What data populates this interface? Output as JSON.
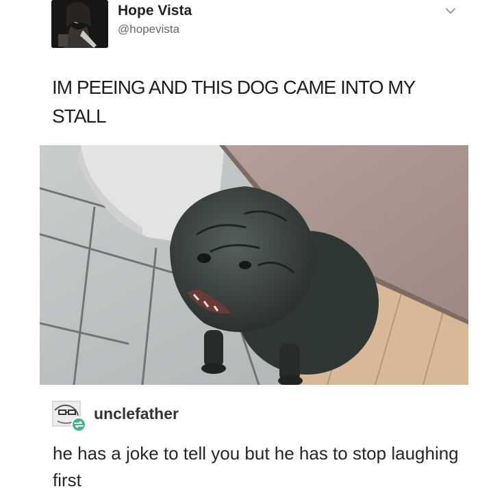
{
  "tweet": {
    "display_name": "Hope Vista",
    "handle": "@hopevista",
    "text": "IM PEEING AND THIS DOG CAME INTO MY STALL",
    "menu_icon": "chevron-down-icon",
    "photo_subject": "dog-photo"
  },
  "reply": {
    "username": "unclefather",
    "text": "he has a joke to tell you but he has to stop laughing first",
    "badge_icon": "tumblr-reblog-badge-icon",
    "badge_color": "#3fb58a"
  },
  "colors": {
    "name": "#222222",
    "handle": "#666666",
    "body_text": "#1e1e1e",
    "background": "#ffffff"
  }
}
